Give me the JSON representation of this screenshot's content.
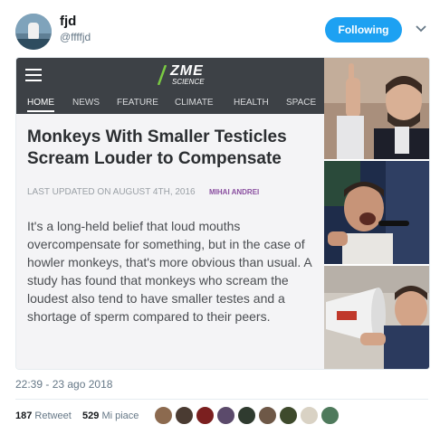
{
  "user": {
    "name": "fjd",
    "handle": "@ffffjd"
  },
  "follow_label": "Following",
  "article": {
    "logo": "ZME",
    "logo_sub": "SCIENCE",
    "nav": [
      "HOME",
      "NEWS",
      "FEATURE",
      "CLIMATE",
      "HEALTH",
      "SPACE"
    ],
    "title_lines": [
      "Monkeys With Smaller Testicles",
      "Scream Louder to Compensate"
    ],
    "updated": "LAST UPDATED ON AUGUST 4TH, 2016",
    "author": "MIHAI ANDREI",
    "body": "It's a long-held belief that loud mouths overcompensate for something, but in the case of howler monkeys, that's more obvious than usual. A study has found that monkeys who scream the loudest also tend to have smaller testes and a shortage of sperm compared to their peers."
  },
  "timestamp": "22:39 - 23 ago 2018",
  "retweets": {
    "count": "187",
    "label": "Retweet"
  },
  "likes": {
    "count": "529",
    "label": "Mi piace"
  },
  "liker_colors": [
    "#8c6a4f",
    "#4a3b32",
    "#7b1f1f",
    "#5b4a6b",
    "#2f3b2f",
    "#6e5847",
    "#3e4a2c",
    "#d9d2c4",
    "#4f7a5c"
  ]
}
